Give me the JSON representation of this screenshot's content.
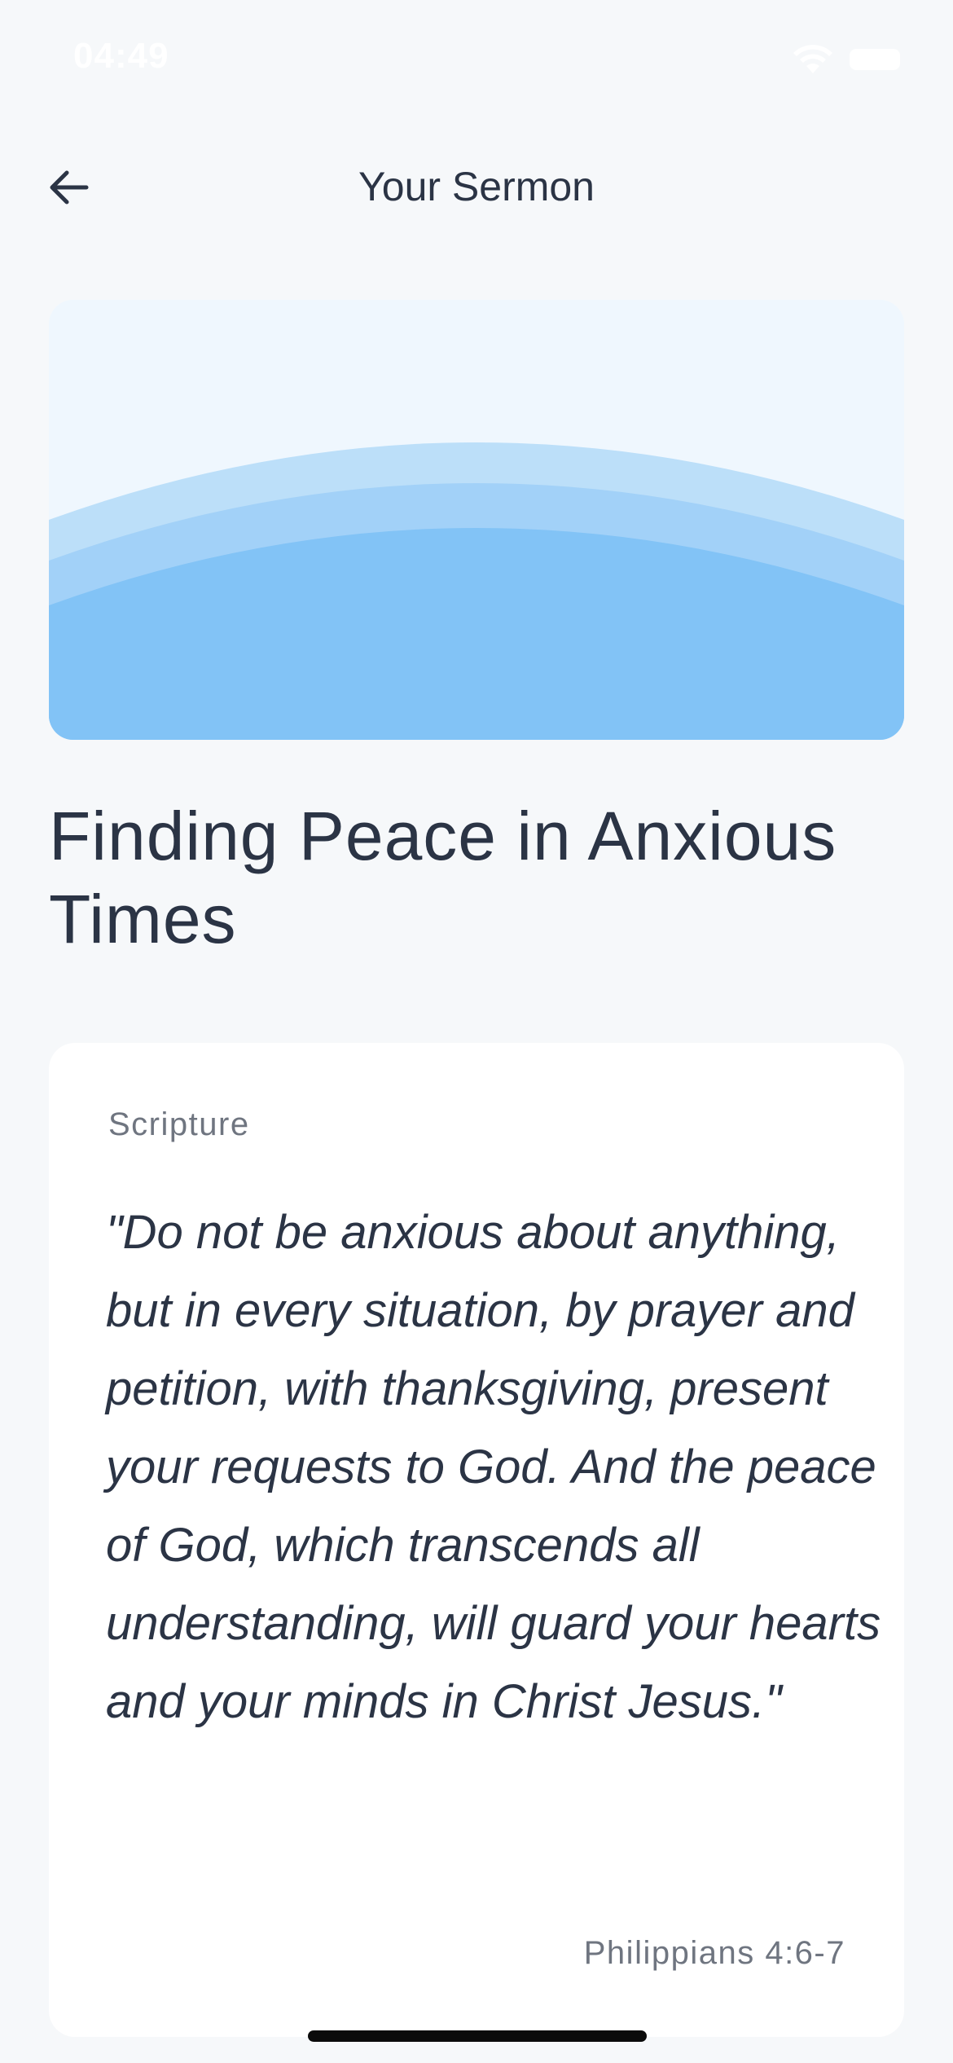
{
  "status_bar": {
    "time": "04:49",
    "wifi_icon": "wifi-icon",
    "battery_icon": "battery-icon"
  },
  "header": {
    "title": "Your Sermon",
    "back_icon": "arrow-left-icon"
  },
  "hero": {
    "colors": [
      "#eff7fe",
      "#bcdff9",
      "#a2d1f8",
      "#82c3f6"
    ]
  },
  "sermon": {
    "title": "Finding Peace in Anxious Times",
    "scripture": {
      "label": "Scripture",
      "text": "\"Do not be anxious about anything, but in every situation, by prayer and petition, with thanksgiving, present your requests to God. And the peace of God, which transcends all understanding, will guard your hearts and your minds in Christ Jesus.\"",
      "reference": "Philippians 4:6-7"
    }
  }
}
